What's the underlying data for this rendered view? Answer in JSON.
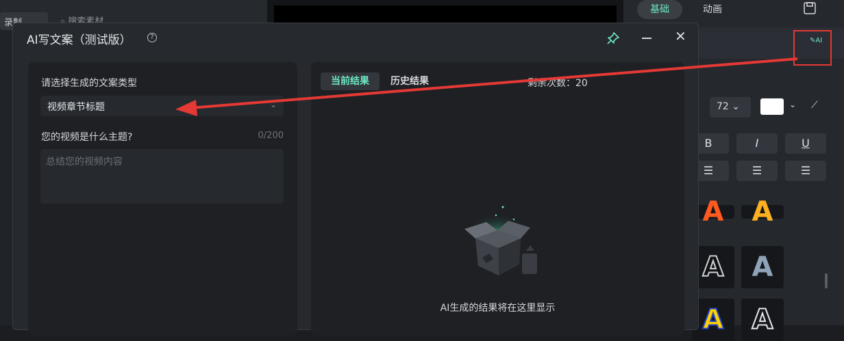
{
  "background": {
    "recording_label": "录制",
    "search_placeholder": "搜索素材",
    "right_tabs": {
      "basic": "基础",
      "animation": "动画"
    },
    "font_size": "72",
    "format_buttons": {
      "bold": "B",
      "italic": "I",
      "underline": "U"
    },
    "ai_icon_label": "AI"
  },
  "dialog": {
    "title": "AI写文案（测试版）",
    "left": {
      "type_label": "请选择生成的文案类型",
      "type_value": "视频章节标题",
      "topic_label": "您的视频是什么主题?",
      "topic_counter": "0/200",
      "topic_placeholder": "总结您的视频内容"
    },
    "right": {
      "tab_current": "当前结果",
      "tab_history": "历史结果",
      "remaining": "剩余次数：20",
      "empty_text": "AI生成的结果将在这里显示"
    }
  },
  "colors": {
    "accent": "#6ee8c4",
    "annotation": "#e53935"
  }
}
